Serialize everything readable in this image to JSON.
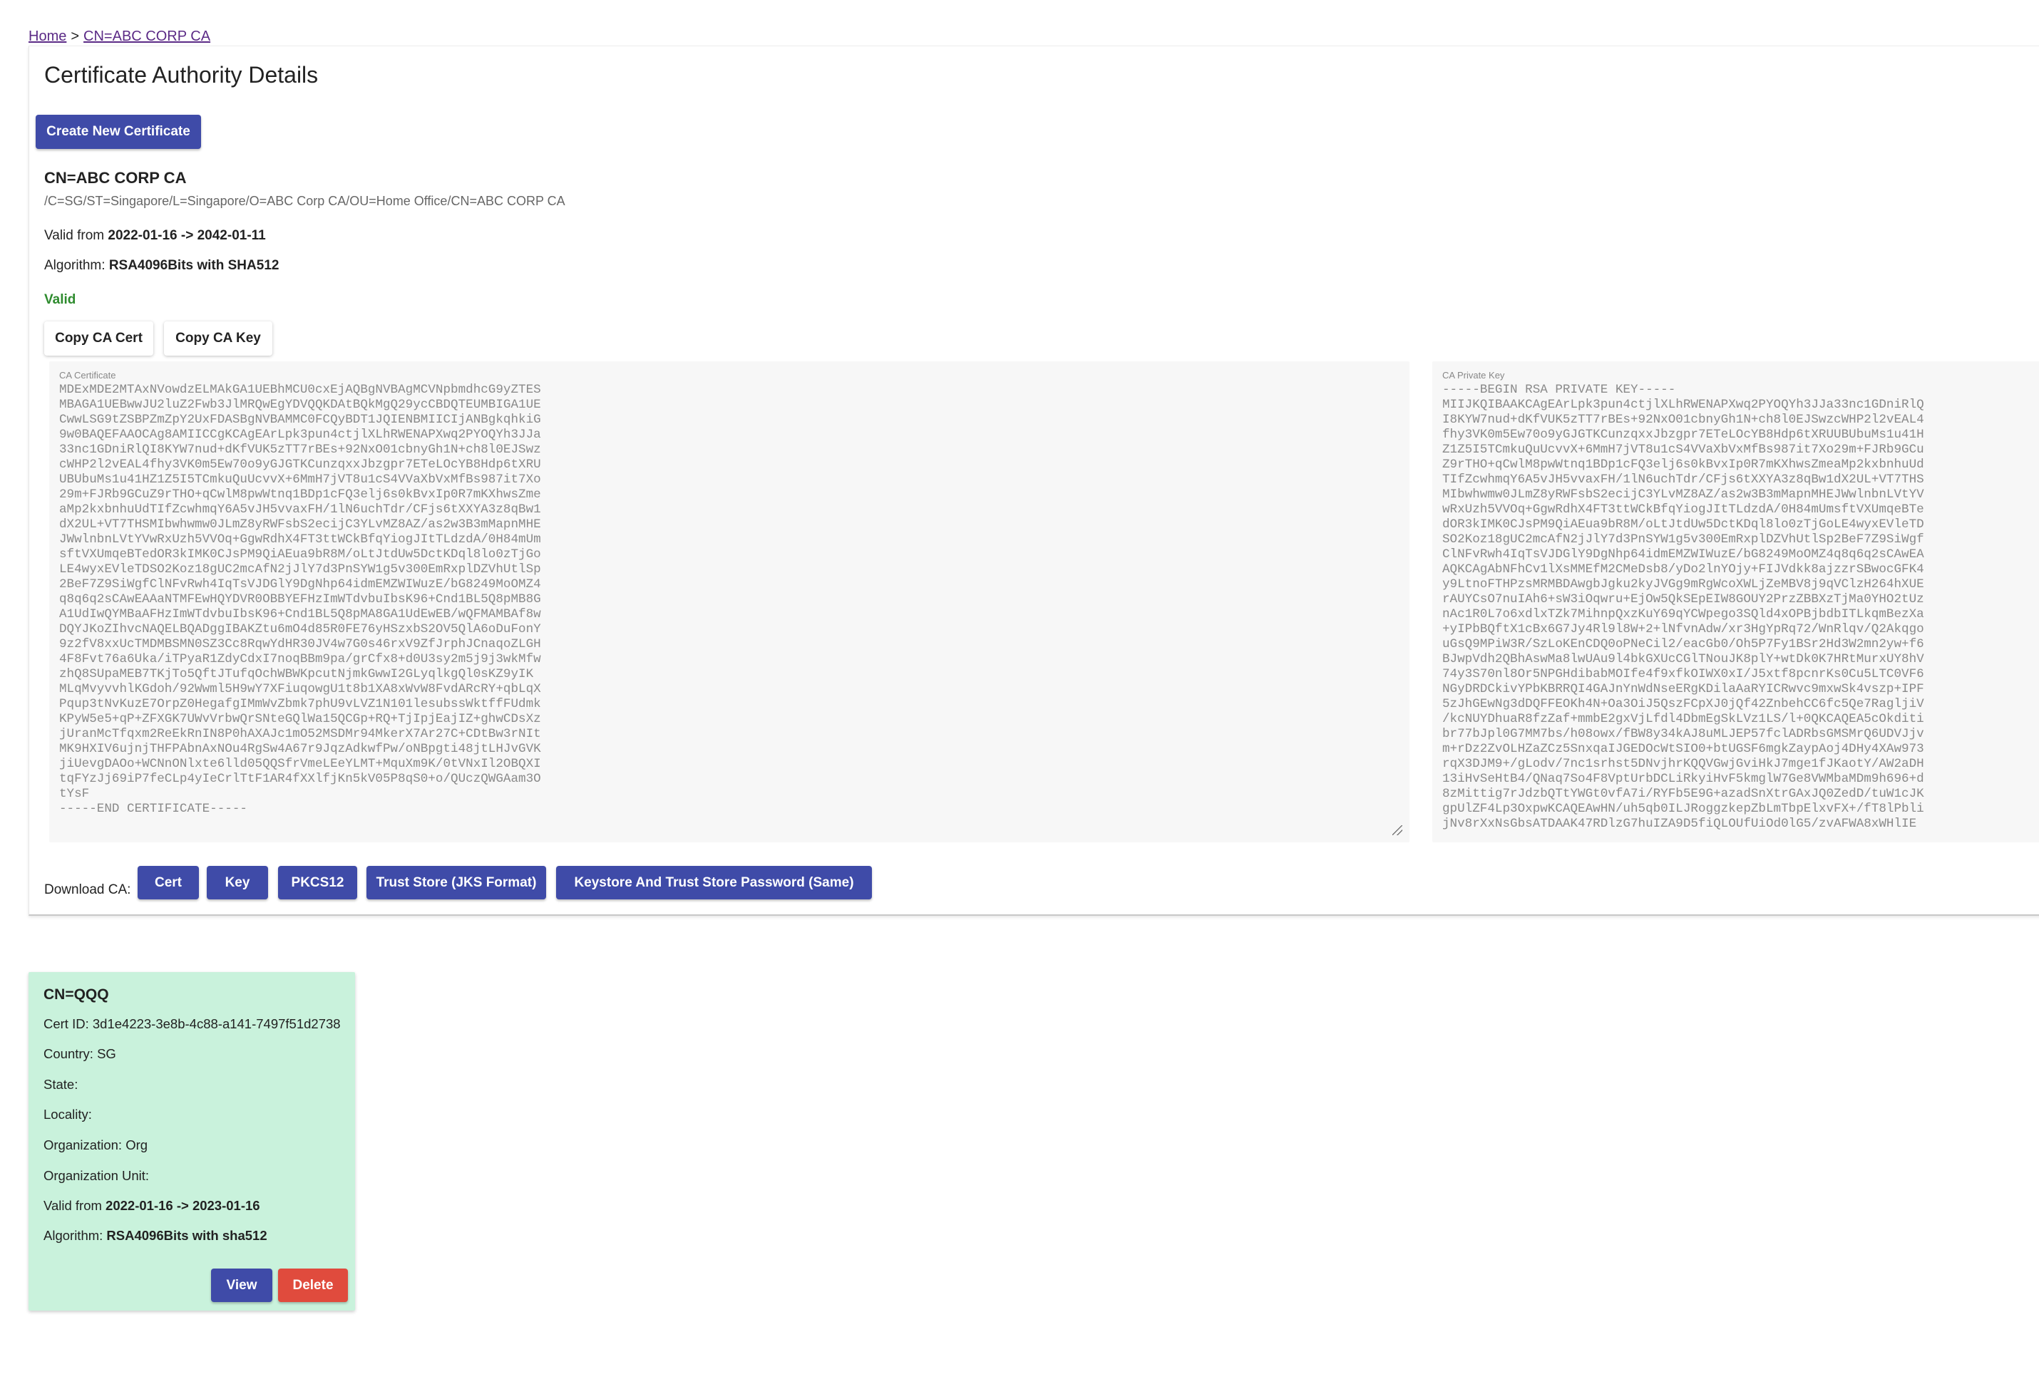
{
  "breadcrumb": {
    "home": "Home",
    "separator": ">",
    "current": "CN=ABC CORP CA"
  },
  "ca": {
    "page_title": "Certificate Authority Details",
    "create_button": "Create New Certificate",
    "name": "CN=ABC CORP CA",
    "dn": "/C=SG/ST=Singapore/L=Singapore/O=ABC Corp CA/OU=Home Office/CN=ABC CORP CA",
    "valid_prefix": "Valid from ",
    "valid_from": "2022-01-16",
    "valid_arrow": " -> ",
    "valid_to": "2042-01-11",
    "algorithm_prefix": "Algorithm: ",
    "algorithm": "RSA4096Bits with SHA512",
    "status": "Valid",
    "copy_cert_button": "Copy CA Cert",
    "copy_key_button": "Copy CA Key",
    "cert_label": "CA Certificate",
    "key_label": "CA Private Key",
    "cert_text": "MDExMDE2MTAxNVowdzELMAkGA1UEBhMCU0cxEjAQBgNVBAgMCVNpbmdhcG9yZTES\nMBAGA1UEBwwJU2luZ2Fwb3JlMRQwEgYDVQQKDAtBQkMgQ29ycCBDQTEUMBIGA1UE\nCwwLSG9tZSBPZmZpY2UxFDASBgNVBAMMC0FCQyBDT1JQIENBMIICIjANBgkqhkiG\n9w0BAQEFAAOCAg8AMIICCgKCAgEArLpk3pun4ctjlXLhRWENAPXwq2PYOQYh3JJa\n33nc1GDniRlQI8KYW7nud+dKfVUK5zTT7rBEs+92NxO01cbnyGh1N+ch8l0EJSwz\ncWHP2l2vEAL4fhy3VK0m5Ew70o9yGJGTKCunzqxxJbzgpr7ETeLOcYB8Hdp6tXRU\nUBUbuMs1u41HZ1Z5I5TCmkuQuUcvvX+6MmH7jVT8u1cS4VVaXbVxMfBs987it7Xo\n29m+FJRb9GCuZ9rTHO+qCwlM8pwWtnq1BDp1cFQ3elj6s0kBvxIp0R7mKXhwsZme\naMp2kxbnhuUdTIfZcwhmqY6A5vJH5vvaxFH/1lN6uchTdr/CFjs6tXXYA3z8qBw1\ndX2UL+VT7THSMIbwhwmw0JLmZ8yRWFsbS2ecijC3YLvMZ8AZ/as2w3B3mMapnMHE\nJWwlnbnLVtYVwRxUzh5VVOq+GgwRdhX4FT3ttWCkBfqYiogJItTLdzdA/0H84mUm\nsftVXUmqeBTedOR3kIMK0CJsPM9QiAEua9bR8M/oLtJtdUw5DctKDql8lo0zTjGo\nLE4wyxEVleTDSO2Koz18gUC2mcAfN2jJlY7d3PnSYW1g5v300EmRxplDZVhUtlSp\n2BeF7Z9SiWgfClNFvRwh4IqTsVJDGlY9DgNhp64idmEMZWIWuzE/bG8249MoOMZ4\nq8q6q2sCAwEAAaNTMFEwHQYDVR0OBBYEFHzImWTdvbuIbsK96+Cnd1BL5Q8pMB8G\nA1UdIwQYMBaAFHzImWTdvbuIbsK96+Cnd1BL5Q8pMA8GA1UdEwEB/wQFMAMBAf8w\nDQYJKoZIhvcNAQELBQADggIBAKZtu6mO4d85R0FE76yHSzxbS2OV5QlA6oDuFonY\n9z2fV8xxUcTMDMBSMN0SZ3Cc8RqwYdHR30JV4w7G0s46rxV9ZfJrphJCnaqoZLGH\n4F8Fvt76a6Uka/iTPyaR1ZdyCdxI7noqBBm9pa/grCfx8+d0U3sy2m5j9j3wkMfw\nzhQ8SUpaMEB7TKjTo5QftJTufqOchWBWKpcutNjmkGwwI2GLyqlkgQl0sKZ9yIK\nMLqMvyvvhlKGdoh/92Wwml5H9wY7XFiuqowgU1t8b1XA8xWvW8FvdARcRY+qbLqX\nPqup3tNvKuzE7OrpZ0HegafgIMmWvZbmk7phU9vLVZ1N101lesubssWktffFUdmk\nKPyW5e5+qP+ZFXGK7UWvVrbwQrSNteGQlWa15QCGp+RQ+TjIpjEajIZ+ghwCDsXz\njUranMcTfqxm2ReEkRnIN8P0hAXAJc1mO52MSDMr94MkerX7Ar27C+CDtBw3rNIt\nMK9HXIV6ujnjTHFPAbnAxNOu4RgSw4A67r9JqzAdkwfPw/oNBpgti48jtLHJvGVK\njiUevgDAOo+WCNnONlxte6lld05QQSfrVmeLEeYLMT+MquXm9K/0tVNxIl2OBQXI\ntqFYzJj69iP7feCLp4yIeCrlTtF1AR4fXXlfjKn5kV05P8qS0+o/QUczQWGAam3O\ntYsF\n-----END CERTIFICATE-----",
    "key_text": "-----BEGIN RSA PRIVATE KEY-----\nMIIJKQIBAAKCAgEArLpk3pun4ctjlXLhRWENAPXwq2PYOQYh3JJa33nc1GDniRlQ\nI8KYW7nud+dKfVUK5zTT7rBEs+92NxO01cbnyGh1N+ch8l0EJSwzcWHP2l2vEAL4\nfhy3VK0m5Ew70o9yGJGTKCunzqxxJbzgpr7ETeLOcYB8Hdp6tXRUUBUbuMs1u41H\nZ1Z5I5TCmkuQuUcvvX+6MmH7jVT8u1cS4VVaXbVxMfBs987it7Xo29m+FJRb9GCu\nZ9rTHO+qCwlM8pwWtnq1BDp1cFQ3elj6s0kBvxIp0R7mKXhwsZmeaMp2kxbnhuUd\nTIfZcwhmqY6A5vJH5vvaxFH/1lN6uchTdr/CFjs6tXXYA3z8qBw1dX2UL+VT7THS\nMIbwhwmw0JLmZ8yRWFsbS2ecijC3YLvMZ8AZ/as2w3B3mMapnMHEJWwlnbnLVtYV\nwRxUzh5VVOq+GgwRdhX4FT3ttWCkBfqYiogJItTLdzdA/0H84mUmsftVXUmqeBTe\ndOR3kIMK0CJsPM9QiAEua9bR8M/oLtJtdUw5DctKDql8lo0zTjGoLE4wyxEVleTD\nSO2Koz18gUC2mcAfN2jJlY7d3PnSYW1g5v300EmRxplDZVhUtlSp2BeF7Z9SiWgf\nClNFvRwh4IqTsVJDGlY9DgNhp64idmEMZWIWuzE/bG8249MoOMZ4q8q6q2sCAwEA\nAQKCAgAbNFhCv1lXsMMEfM2CMeDsb8/yDo2lnYOjy+FIJVdkk8ajzzrSBwocGFK4\ny9LtnoFTHPzsMRMBDAwgbJgku2kyJVGg9mRgWcoXWLjZeMBV8j9qVClzH264hXUE\nrAUYCsO7nuIAh6+sW3iOqwru+EjOw5QkSEpEIW8GOUY2PrzZBBXzTjMa0YHO2tUz\nnAc1R0L7o6xdlxTZk7MihnpQxzKuY69qYCWpego3SQld4xOPBjbdbITLkqmBezXa\n+yIPbBQftX1cBx6G7Jy4Rl9l8W+2+lNfvnAdw/xr3HgYpRq72/WnRlqv/Q2Akqgo\nuGsQ9MPiW3R/SzLoKEnCDQ0oPNeCil2/eacGb0/Oh5P7Fy1BSr2Hd3W2mn2yw+f6\nBJwpVdh2QBhAswMa8lwUAu9l4bkGXUcCGlTNouJK8plY+wtDk0K7HRtMurxUY8hV\n74y3S70nl8Or5NPGHdibabMOIfe4f9xfkOIWX0xI/J5xtf8pcnrKs0Cu5LTC0VF6\nNGyDRDCkivYPbKBRRQI4GAJnYnWdNseERgKDilaAaRYICRwvc9mxwSk4vszp+IPF\n5zJhGEwNg3dDQFFEOKh4N+Oa3OiJ5QszFCpXJ0jQf42ZnbehCC6fc5Qe7RagljiV\n/kcNUYDhuaR8fzZaf+mmbE2gxVjLfdl4DbmEgSkLVz1LS/l+0QKCAQEA5cOkditi\nbr77bJpl0G7MM7bs/h08owx/fBW8y34kAJ8uMLJEP57fclADRbsGMSMrQ6UDVJjv\nm+rDz2ZvOLHZaZCz5SnxqaIJGEDOcWtSIO0+btUGSF6mgkZaypAoj4DHy4XAw973\nrqX3DJM9+/gLodv/7nc1srhst5DNvjhrKQQVGwjGviHkJ7mge1fJKaotY/AW2aDH\n13iHvSeHtB4/QNaq7So4F8VptUrbDCLiRkyiHvF5kmglW7Ge8VWMbaMDm9h696+d\n8zMittig7rJdzbQTtYWGt0vfA7i/RYFb5E9G+azadSnXtrGAxJQ0ZedD/tuW1cJK\ngpUlZF4Lp3OxpwKCAQEAwHN/uh5qb0ILJRoggzkepZbLmTbpElxvFX+/fT8lPbli\njNv8rXxNsGbsATDAAK47RDlzG7huIZA9D5fiQLOUfUiOd0lG5/zvAFWA8xWHlIE"
  },
  "download": {
    "label": "Download CA:",
    "cert": "Cert",
    "key": "Key",
    "pkcs12": "PKCS12",
    "truststore": "Trust Store (JKS Format)",
    "password": "Keystore And Trust Store Password (Same)"
  },
  "cert_card": {
    "title": "CN=QQQ",
    "cert_id_label": "Cert ID: ",
    "cert_id": "3d1e4223-3e8b-4c88-a141-7497f51d2738",
    "country_label": "Country: ",
    "country": "SG",
    "state_label": "State: ",
    "state": "",
    "locality_label": "Locality: ",
    "locality": "",
    "org_label": "Organization: ",
    "org": "Org",
    "ou_label": "Organization Unit: ",
    "ou": "",
    "valid_prefix": "Valid from ",
    "valid_from": "2022-01-16",
    "valid_arrow": " -> ",
    "valid_to": "2023-01-16",
    "algorithm_prefix": "Algorithm: ",
    "algorithm": "RSA4096Bits with sha512",
    "view_button": "View",
    "delete_button": "Delete",
    "card_color": "#c9f2dc"
  },
  "colors": {
    "primary": "#3f4ba8",
    "danger": "#e04b3d",
    "valid": "#2e8b2e",
    "link": "#5b2a86"
  }
}
